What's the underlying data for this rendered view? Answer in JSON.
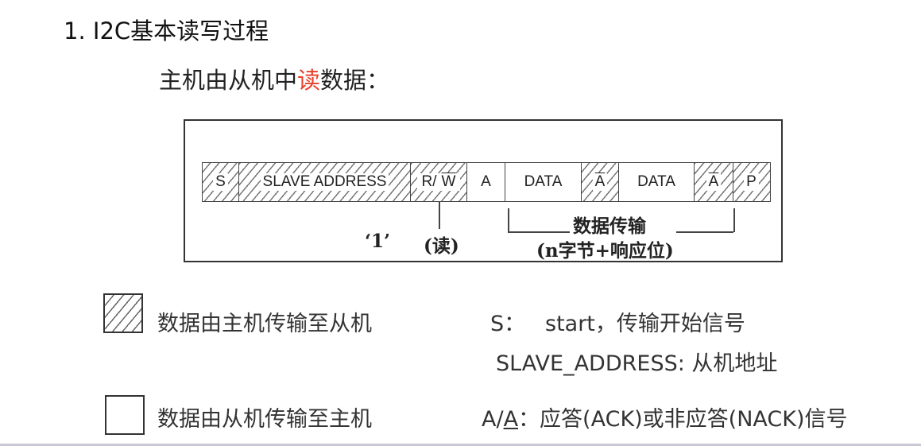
{
  "title": "1. I2C基本读写过程",
  "subtitle": {
    "prefix": "主机由从机中",
    "highlight": "读",
    "suffix": "数据："
  },
  "frame": {
    "s": "S",
    "slave_address": "SLAVE ADDRESS",
    "rw_r": "R/",
    "rw_w": "W",
    "a": "A",
    "data1": "DATA",
    "a_bar1": "A",
    "data2": "DATA",
    "a_bar2": "A",
    "p": "P"
  },
  "annotations": {
    "one": "‘1’",
    "read": "(读)",
    "transfer": "数据传输",
    "bytes": "(n字节+响应位)"
  },
  "legend": {
    "host_to_slave": "数据由主机传输至从机",
    "slave_to_host": "数据由从机传输至主机"
  },
  "definitions": {
    "s_label": "S：",
    "s_desc": "start，传输开始信号",
    "slave_addr": "SLAVE_ADDRESS: 从机地址",
    "ack_prefix": "A/",
    "ack_under": "A",
    "ack_desc": "：应答(ACK)或非应答(NACK)信号"
  },
  "colors": {
    "highlight": "#e8402a",
    "hatch": "#777777"
  }
}
